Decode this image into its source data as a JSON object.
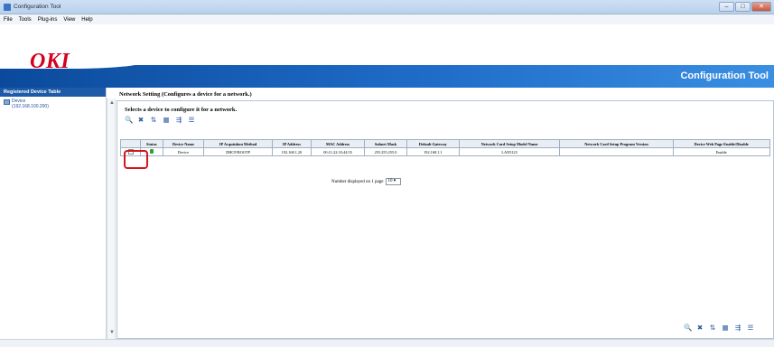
{
  "window": {
    "title": "Configuration Tool"
  },
  "menu": [
    "File",
    "Tools",
    "Plug-ins",
    "View",
    "Help"
  ],
  "banner": {
    "logo": "OKI",
    "title": "Configuration Tool"
  },
  "left_panel": {
    "header": "Registered Device Table",
    "items": [
      {
        "name": "Device",
        "ip": "(192.168.100.200)"
      }
    ]
  },
  "main": {
    "title": "Network Setting (Configures a device for a network.)",
    "subtitle": "Selects a device to configure it for a network.",
    "toolbar_icons": [
      "search-icon",
      "delete-icon",
      "sort-icon",
      "grid-icon",
      "filter-icon",
      "list-icon"
    ],
    "table": {
      "headers": [
        "",
        "Status",
        "Device Name",
        "IP Acquisition Method",
        "IP Address",
        "MAC Address",
        "Subnet Mask",
        "Default Gateway",
        "Network Card Setup Model Name",
        "Network Card Setup Program Version",
        "Device Web Page Enable/Disable"
      ],
      "rows": [
        {
          "name": "Device",
          "method": "DHCP/BOOTP",
          "ip": "192.168.1.20",
          "mac": "00:11:22:33:44:55",
          "subnet": "255.255.255.0",
          "gateway": "192.168.1.1",
          "model": "LAN5123",
          "version": "",
          "webpage": "Enable"
        }
      ]
    },
    "per_page_label": "Number displayed on 1 page",
    "per_page_value": "10"
  },
  "colors": {
    "oki_red": "#d4001e",
    "banner_blue": "#1f6cc8",
    "highlight": "#d4151c"
  }
}
